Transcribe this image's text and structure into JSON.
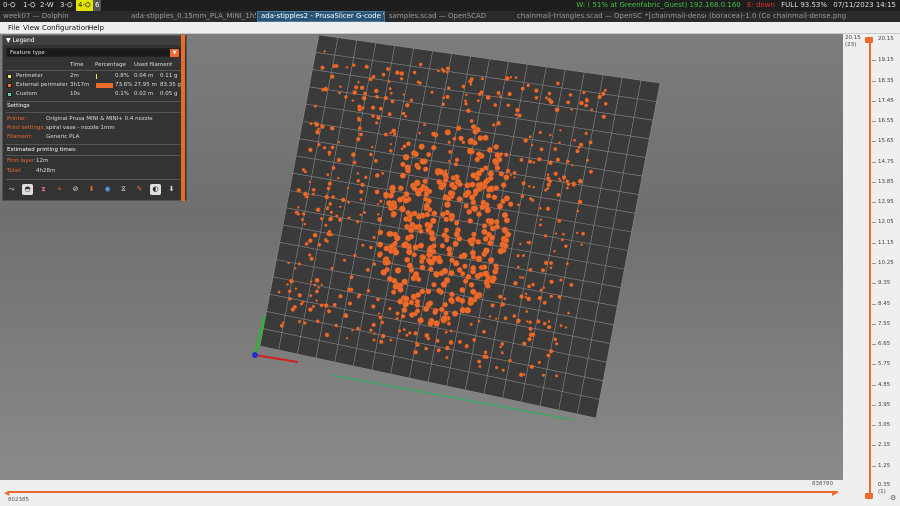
{
  "topbar": {
    "workspaces": [
      {
        "label": "0-⛭",
        "active": false
      },
      {
        "label": "1-⛭",
        "active": false
      },
      {
        "label": "2-W",
        "active": false
      },
      {
        "label": "3-⛭",
        "active": false
      },
      {
        "label": "4-⛭",
        "active": true
      },
      {
        "label": "6",
        "active": false
      }
    ],
    "wifi": "W: ( 51% at Greenfabric_Guest) 192.168.0.160",
    "eth": "E: down",
    "battery": "FULL 93.53%",
    "datetime": "07/11/2023 14:15"
  },
  "windows": [
    {
      "title": "week07 — Dolphin",
      "focused": false
    },
    {
      "title": "ada-stipples_0.15mm_PLA_MINI_1h54m",
      "focused": false
    },
    {
      "title": "ada-stipples2 - PrusaSlicer G-code Viewer",
      "focused": true
    },
    {
      "title": "samples.scad — OpenSCAD",
      "focused": false
    },
    {
      "title": "chainmail-triangles.scad — OpenSCAD",
      "focused": false
    },
    {
      "title": "*[chainmail-dense]",
      "focused": false
    },
    {
      "title": "(boracea)-1.0 (Couleur)",
      "focused": false
    },
    {
      "title": "chainmail-dense.png",
      "focused": false
    }
  ],
  "menu": [
    "File",
    "View",
    "Configuration",
    "Help"
  ],
  "legend": {
    "title": "Legend",
    "view_type": "Feature type",
    "columns": {
      "time": "Time",
      "percentage": "Percentage",
      "filament": "Used filament"
    },
    "rows": [
      {
        "name": "Perimeter",
        "time": "2m",
        "percent": "0.8%",
        "length": "0.04 m",
        "weight": "0.11 g",
        "color": "#ffe75a",
        "fraction": 0.008
      },
      {
        "name": "External perimeter",
        "time": "3h17m",
        "percent": "73.6%",
        "length": "27.95 m",
        "weight": "83.35 g",
        "color": "#ec6a2b",
        "fraction": 0.736
      },
      {
        "name": "Custom",
        "time": "10s",
        "percent": "0.1%",
        "length": "0.02 m",
        "weight": "0.05 g",
        "color": "#5ed6a0",
        "fraction": 0.001
      }
    ],
    "settings_header": "Settings",
    "settings": [
      {
        "key": "Printer:",
        "value": "Original Prusa MINI & MINI+ 0.4 nozzle"
      },
      {
        "key": "Print settings:",
        "value": "spiral vase - nozzle 1mm"
      },
      {
        "key": "Filament:",
        "value": "Generic PLA"
      }
    ],
    "times_header": "Estimated printing times:",
    "times": [
      {
        "key": "First layer:",
        "value": "12m"
      },
      {
        "key": "Total:",
        "value": "4h28m"
      }
    ],
    "toolbar_icons": [
      "travel-icon",
      "wipe-icon",
      "retractions-icon",
      "deretractions-icon",
      "seams-icon",
      "tool-changes-icon",
      "color-changes-icon",
      "pause-prints-icon",
      "custom-gcodes-icon",
      "center-of-gravity-icon",
      "shells-icon",
      "tool-marker-icon"
    ]
  },
  "layer_slider": {
    "top_value": "20.15",
    "top_index": "(23)",
    "bottom_value": "0.35",
    "bottom_index": "(1)",
    "ticks": [
      "20.15",
      "19.15",
      "18.35",
      "17.45",
      "16.55",
      "15.65",
      "14.75",
      "13.85",
      "12.95",
      "12.05",
      "11.15",
      "10.25",
      "9.35",
      "8.45",
      "7.55",
      "6.65",
      "5.75",
      "4.85",
      "3.95",
      "3.05",
      "2.15",
      "1.25",
      "0.35"
    ]
  },
  "move_slider": {
    "left": "802385",
    "right": "838780"
  },
  "colors": {
    "accent": "#ec6a2b",
    "bed": "#3a3a3a",
    "grid": "#8a8a8a",
    "axis_x": "#d02020",
    "axis_y": "#20c020",
    "axis_z": "#2030d0"
  }
}
